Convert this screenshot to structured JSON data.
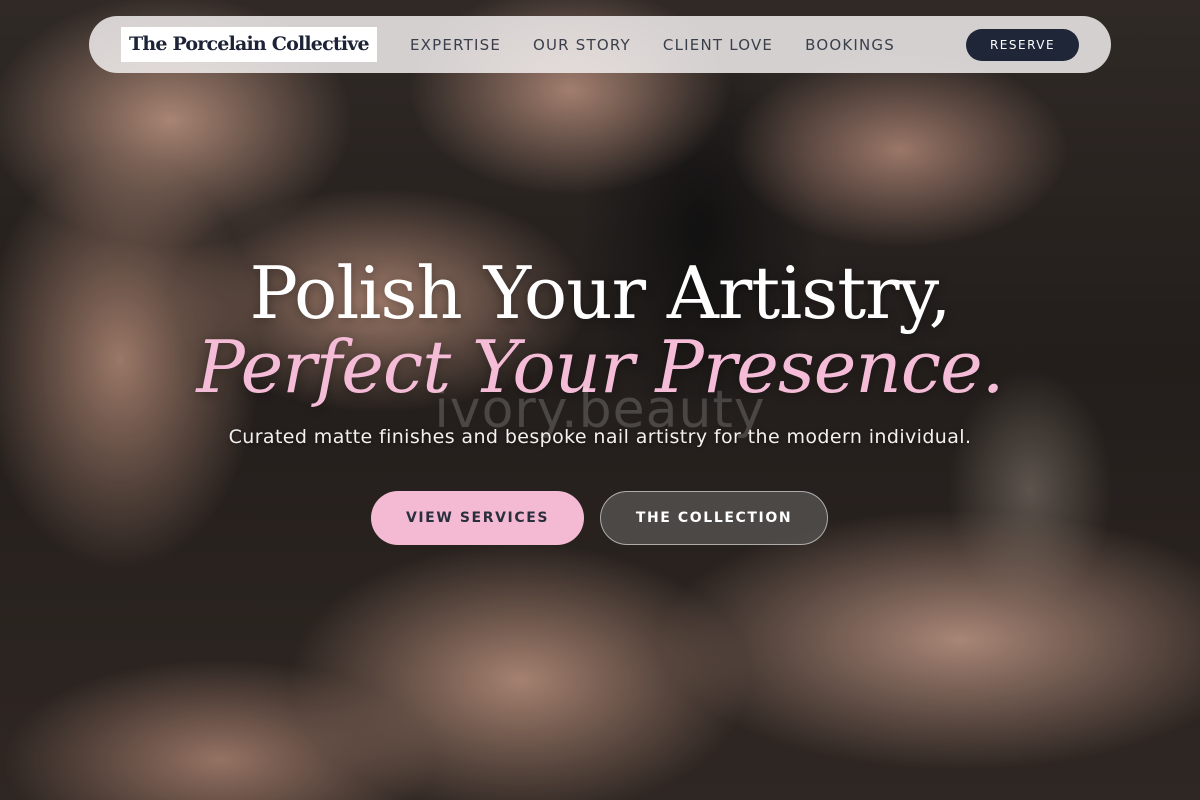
{
  "brand": {
    "logo_text": "The Porcelain Collective"
  },
  "nav": {
    "links": [
      "EXPERTISE",
      "OUR STORY",
      "CLIENT LOVE",
      "BOOKINGS"
    ],
    "reserve_label": "RESERVE"
  },
  "hero": {
    "headline_line1": "Polish Your Artistry,",
    "headline_line2": "Perfect Your Presence.",
    "watermark": "ivory.beauty",
    "subheadline": "Curated matte finishes and bespoke nail artistry for the modern individual.",
    "primary_cta": "VIEW SERVICES",
    "secondary_cta": "THE COLLECTION"
  },
  "colors": {
    "accent_pink": "#f4bad3",
    "navy": "#1f2638",
    "nav_bg": "#f0ecec"
  }
}
